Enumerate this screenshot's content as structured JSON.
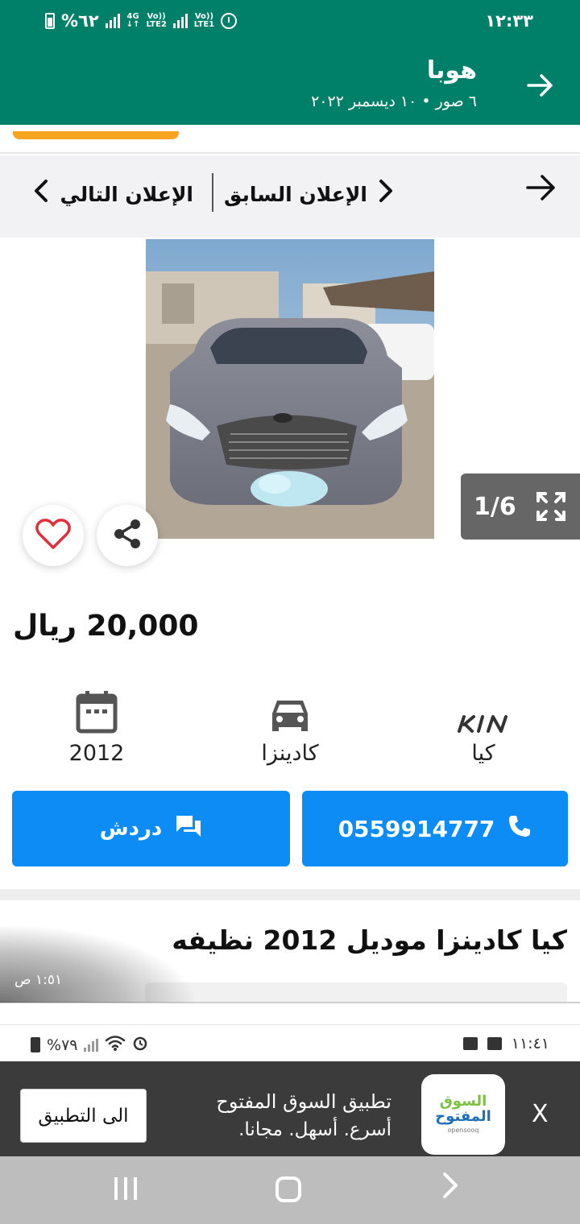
{
  "viewer": {
    "status_left": "%٦٢",
    "net1_top": "4G",
    "net1_bottom": "↓↑",
    "net2_top": "Vo))",
    "net2_bottom": "LTE2",
    "net3_top": "Vo))",
    "net3_bottom": "LTE1",
    "time": "١٢:٣٣",
    "title": "هوبا",
    "subtitle": "٦ صور • ١٠ ديسمبر ٢٠٢٢"
  },
  "nav": {
    "prev_label": "الإعلان السابق",
    "next_label": "الإعلان التالي"
  },
  "gallery": {
    "counter": "1/6"
  },
  "listing": {
    "price": "20,000 ريال",
    "specs": {
      "year": "2012",
      "model": "كادينزا",
      "make": "كيا"
    },
    "chat_label": "دردش",
    "phone_label": "0559914777",
    "title": "كيا كادينزا موديل 2012 نظيفه"
  },
  "message_time": "١:٥١ ص",
  "inner_status": {
    "battery": "%٧٩",
    "time": "١١:٤١"
  },
  "banner": {
    "open_app_label": "الى التطبيق",
    "title": "تطبيق السوق المفتوح",
    "subtitle": "أسرع. أسهل. مجانا.",
    "logo_line1": "السوق",
    "logo_line2": "المفتوح",
    "logo_line3": "opensooq",
    "close_label": "X"
  },
  "colors": {
    "viewer_header": "#008069",
    "accent_blue": "#0d8cf5",
    "orange": "#f7a521",
    "banner_bg": "#3b3b3b"
  },
  "icons": [
    "back-arrow-icon",
    "chevron-right-icon",
    "chevron-left-icon",
    "expand-icon",
    "heart-icon",
    "share-icon",
    "calendar-icon",
    "car-icon",
    "kia-logo",
    "chat-icon",
    "phone-icon"
  ]
}
